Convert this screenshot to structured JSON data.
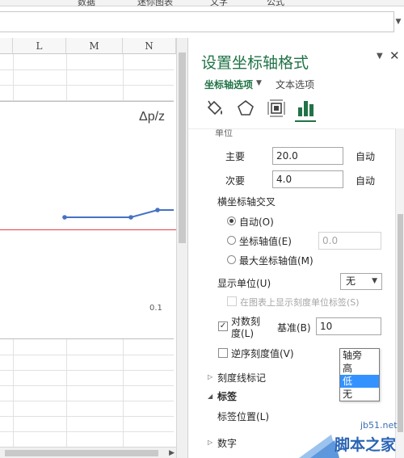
{
  "ribbon": {
    "items": [
      "数据",
      "迷你图表",
      "文字",
      "公式"
    ]
  },
  "formula_bar": {
    "expand_icon": "chevron-down-icon"
  },
  "sheet": {
    "columns": [
      "L",
      "M",
      "N"
    ],
    "chart": {
      "title": "Δp/z",
      "tick_label": "0.1",
      "series_color": "#4472c4",
      "red_line_color": "#e4404a"
    }
  },
  "pane": {
    "title": "设置坐标轴格式",
    "menu_icon": "chevron-down-icon",
    "close_icon": "close-icon",
    "tabs": {
      "axis_options": "坐标轴选项",
      "text_options": "文本选项"
    },
    "icons": [
      "fill-line-icon",
      "effects-pentagon-icon",
      "size-properties-icon",
      "axis-options-bar-icon"
    ],
    "section_stub": "单位",
    "units": {
      "major_label": "主要",
      "major_value": "20.0",
      "major_auto": "自动",
      "minor_label": "次要",
      "minor_value": "4.0",
      "minor_auto": "自动"
    },
    "cross": {
      "heading": "横坐标轴交叉",
      "auto": "自动(O)",
      "axis_value": "坐标轴值(E)",
      "axis_value_input": "0.0",
      "max_value": "最大坐标轴值(M)"
    },
    "display_units": {
      "label": "显示单位(U)",
      "value": "无",
      "show_label": "在图表上显示刻度单位标签(S)"
    },
    "log_scale": {
      "label_line1": "对数刻",
      "label_line2": "度(L)",
      "base_label": "基准(B)",
      "base_value": "10"
    },
    "reverse": {
      "label": "逆序刻度值(V)"
    },
    "label_position_options": [
      "轴旁",
      "高",
      "低",
      "无"
    ],
    "label_position_selected": "低",
    "tick_marks": {
      "label": "刻度线标记"
    },
    "labels_section": {
      "label": "标签",
      "position_label": "标签位置(L)"
    },
    "number_section": {
      "label": "数字"
    }
  },
  "watermark": {
    "url": "jb51.net",
    "name": "脚本之家"
  },
  "colors": {
    "accent": "#217346",
    "selection": "#3392ff"
  }
}
